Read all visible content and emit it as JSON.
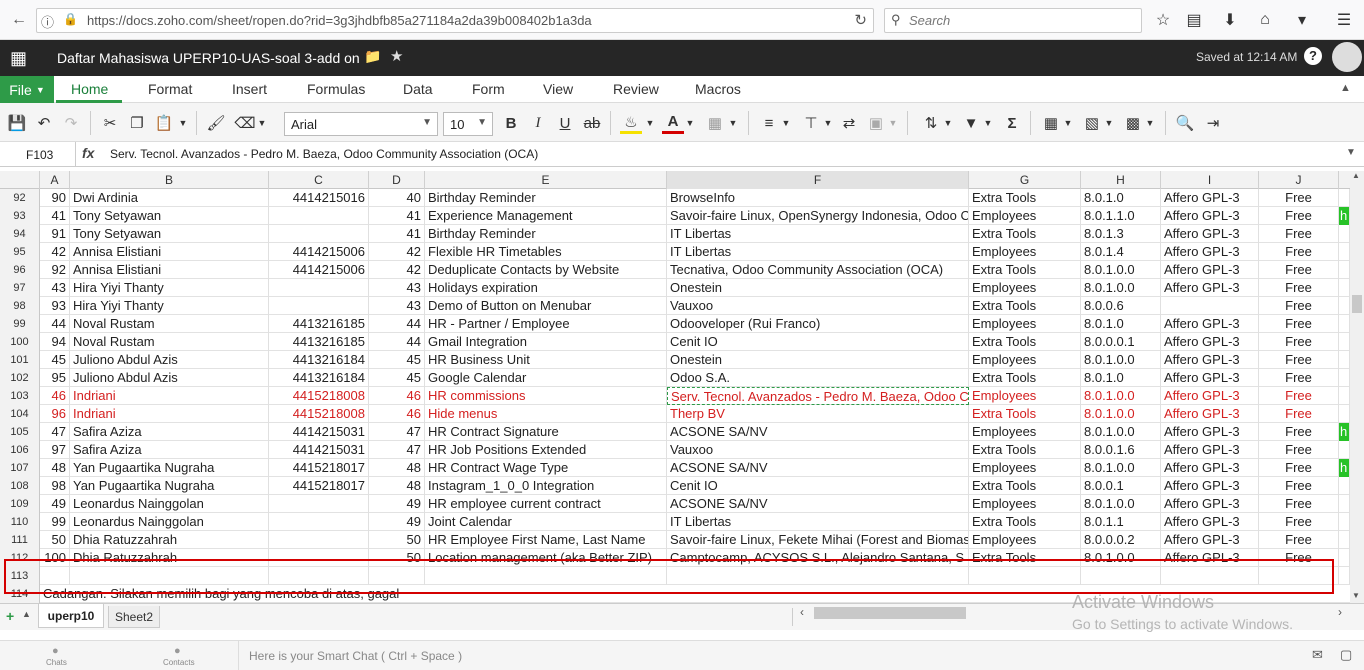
{
  "browser": {
    "url": "https://docs.zoho.com/sheet/ropen.do?rid=3g3jhdbfb85a271184a2da39b008402b1a3da",
    "search_placeholder": "Search"
  },
  "app": {
    "doc_title": "Daftar Mahasiswa UPERP10-UAS-soal 3-add on",
    "saved_status": "Saved at 12:14 AM"
  },
  "menu": {
    "file_label": "File",
    "tabs": [
      "Home",
      "Format",
      "Insert",
      "Formulas",
      "Data",
      "Form",
      "View",
      "Review",
      "Macros"
    ]
  },
  "toolbar": {
    "font_name": "Arial",
    "font_size": "10"
  },
  "formula_bar": {
    "cell_ref": "F103",
    "fx": "fx",
    "content": "Serv. Tecnol. Avanzados - Pedro M. Baeza, Odoo Community Association (OCA)"
  },
  "columns": [
    "A",
    "B",
    "C",
    "D",
    "E",
    "F",
    "G",
    "H",
    "I",
    "J"
  ],
  "rows": [
    {
      "n": "92",
      "a": "90",
      "b": "Dwi Ardinia",
      "c": "4414215016",
      "d": "40",
      "e": "Birthday Reminder",
      "f": "BrowseInfo",
      "g": "Extra Tools",
      "h": "8.0.1.0",
      "i": "Affero GPL-3",
      "j": "Free",
      "k": ""
    },
    {
      "n": "93",
      "a": "41",
      "b": "Tony Setyawan",
      "c": "",
      "d": "41",
      "e": "Experience Management",
      "f": "Savoir-faire Linux, OpenSynergy Indonesia, Odoo Co",
      "g": "Employees",
      "h": "8.0.1.1.0",
      "i": "Affero GPL-3",
      "j": "Free",
      "k": "h"
    },
    {
      "n": "94",
      "a": "91",
      "b": "Tony Setyawan",
      "c": "",
      "d": "41",
      "e": "Birthday Reminder",
      "f": "IT Libertas",
      "g": "Extra Tools",
      "h": "8.0.1.3",
      "i": "Affero GPL-3",
      "j": "Free",
      "k": ""
    },
    {
      "n": "95",
      "a": "42",
      "b": "Annisa Elistiani",
      "c": "4414215006",
      "d": "42",
      "e": "Flexible HR Timetables",
      "f": "IT Libertas",
      "g": "Employees",
      "h": "8.0.1.4",
      "i": "Affero GPL-3",
      "j": "Free",
      "k": ""
    },
    {
      "n": "96",
      "a": "92",
      "b": "Annisa Elistiani",
      "c": "4414215006",
      "d": "42",
      "e": "Deduplicate Contacts by Website",
      "f": "Tecnativa, Odoo Community Association (OCA)",
      "g": "Extra Tools",
      "h": "8.0.1.0.0",
      "i": "Affero GPL-3",
      "j": "Free",
      "k": ""
    },
    {
      "n": "97",
      "a": "43",
      "b": "Hira Yiyi Thanty",
      "c": "",
      "d": "43",
      "e": "Holidays expiration",
      "f": "Onestein",
      "g": "Employees",
      "h": "8.0.1.0.0",
      "i": "Affero GPL-3",
      "j": "Free",
      "k": ""
    },
    {
      "n": "98",
      "a": "93",
      "b": "Hira Yiyi Thanty",
      "c": "",
      "d": "43",
      "e": "Demo of Button on Menubar",
      "f": "Vauxoo",
      "g": "Extra Tools",
      "h": "8.0.0.6",
      "i": "",
      "j": "Free",
      "k": ""
    },
    {
      "n": "99",
      "a": "44",
      "b": "Noval Rustam",
      "c": "4413216185",
      "d": "44",
      "e": "HR - Partner / Employee",
      "f": "Odooveloper (Rui Franco)",
      "g": "Employees",
      "h": "8.0.1.0",
      "i": "Affero GPL-3",
      "j": "Free",
      "k": ""
    },
    {
      "n": "100",
      "a": "94",
      "b": "Noval Rustam",
      "c": "4413216185",
      "d": "44",
      "e": "Gmail Integration",
      "f": "Cenit IO",
      "g": "Extra Tools",
      "h": "8.0.0.0.1",
      "i": "Affero GPL-3",
      "j": "Free",
      "k": ""
    },
    {
      "n": "101",
      "a": "45",
      "b": "Juliono Abdul Azis",
      "c": "4413216184",
      "d": "45",
      "e": "HR Business Unit",
      "f": "Onestein",
      "g": "Employees",
      "h": "8.0.1.0.0",
      "i": "Affero GPL-3",
      "j": "Free",
      "k": ""
    },
    {
      "n": "102",
      "a": "95",
      "b": "Juliono Abdul Azis",
      "c": "4413216184",
      "d": "45",
      "e": "Google Calendar",
      "f": "Odoo S.A.",
      "g": "Extra Tools",
      "h": "8.0.1.0",
      "i": "Affero GPL-3",
      "j": "Free",
      "k": ""
    },
    {
      "n": "103",
      "a": "46",
      "b": "Indriani",
      "c": "4415218008",
      "d": "46",
      "e": "HR commissions",
      "f": "Serv. Tecnol. Avanzados - Pedro M. Baeza, Odoo Co",
      "g": "Employees",
      "h": "8.0.1.0.0",
      "i": "Affero GPL-3",
      "j": "Free",
      "k": "",
      "red": true
    },
    {
      "n": "104",
      "a": "96",
      "b": "Indriani",
      "c": "4415218008",
      "d": "46",
      "e": "Hide menus",
      "f": "Therp BV",
      "g": "Extra Tools",
      "h": "8.0.1.0.0",
      "i": "Affero GPL-3",
      "j": "Free",
      "k": "",
      "red": true
    },
    {
      "n": "105",
      "a": "47",
      "b": "Safira Aziza",
      "c": "4414215031",
      "d": "47",
      "e": "HR Contract Signature",
      "f": "ACSONE SA/NV",
      "g": "Employees",
      "h": "8.0.1.0.0",
      "i": "Affero GPL-3",
      "j": "Free",
      "k": "h"
    },
    {
      "n": "106",
      "a": "97",
      "b": "Safira Aziza",
      "c": "4414215031",
      "d": "47",
      "e": "HR Job Positions Extended",
      "f": "Vauxoo",
      "g": "Extra Tools",
      "h": "8.0.0.1.6",
      "i": "Affero GPL-3",
      "j": "Free",
      "k": ""
    },
    {
      "n": "107",
      "a": "48",
      "b": "Yan Pugaartika Nugraha",
      "c": "4415218017",
      "d": "48",
      "e": "HR Contract Wage Type",
      "f": "ACSONE SA/NV",
      "g": "Employees",
      "h": "8.0.1.0.0",
      "i": "Affero GPL-3",
      "j": "Free",
      "k": "h"
    },
    {
      "n": "108",
      "a": "98",
      "b": "Yan Pugaartika Nugraha",
      "c": "4415218017",
      "d": "48",
      "e": "Instagram_1_0_0 Integration",
      "f": "Cenit IO",
      "g": "Extra Tools",
      "h": "8.0.0.1",
      "i": "Affero GPL-3",
      "j": "Free",
      "k": ""
    },
    {
      "n": "109",
      "a": "49",
      "b": "Leonardus Nainggolan",
      "c": "",
      "d": "49",
      "e": "HR employee current contract",
      "f": "ACSONE SA/NV",
      "g": "Employees",
      "h": "8.0.1.0.0",
      "i": "Affero GPL-3",
      "j": "Free",
      "k": ""
    },
    {
      "n": "110",
      "a": "99",
      "b": "Leonardus Nainggolan",
      "c": "",
      "d": "49",
      "e": "Joint Calendar",
      "f": "IT Libertas",
      "g": "Extra Tools",
      "h": "8.0.1.1",
      "i": "Affero GPL-3",
      "j": "Free",
      "k": ""
    },
    {
      "n": "111",
      "a": "50",
      "b": "Dhia Ratuzzahrah",
      "c": "",
      "d": "50",
      "e": "HR Employee First Name, Last Name",
      "f": "Savoir-faire Linux, Fekete Mihai (Forest and Biomas",
      "g": "Employees",
      "h": "8.0.0.0.2",
      "i": "Affero GPL-3",
      "j": "Free",
      "k": ""
    },
    {
      "n": "112",
      "a": "100",
      "b": "Dhia Ratuzzahrah",
      "c": "",
      "d": "50",
      "e": "Location management (aka Better ZIP)",
      "f": "Camptocamp, ACYSOS S.L., Alejandro Santana, S",
      "g": "Extra Tools",
      "h": "8.0.1.0.0",
      "i": "Affero GPL-3",
      "j": "Free",
      "k": ""
    },
    {
      "n": "113",
      "a": "",
      "b": "",
      "c": "",
      "d": "",
      "e": "",
      "f": "",
      "g": "",
      "h": "",
      "i": "",
      "j": "",
      "k": ""
    }
  ],
  "row114": {
    "n": "114",
    "text": "Cadangan. Silakan memilih bagi yang mencoba di atas, gagal"
  },
  "sheets": [
    "uperp10",
    "Sheet2"
  ],
  "watermark": {
    "line1": "Activate Windows",
    "line2": "Go to Settings to activate Windows."
  },
  "chat": {
    "chats": "Chats",
    "contacts": "Contacts",
    "placeholder": "Here is your Smart Chat ( Ctrl + Space )"
  },
  "colors": {
    "accent": "#2e9b48",
    "highlight_red": "#d42020",
    "appbar": "#262626"
  }
}
